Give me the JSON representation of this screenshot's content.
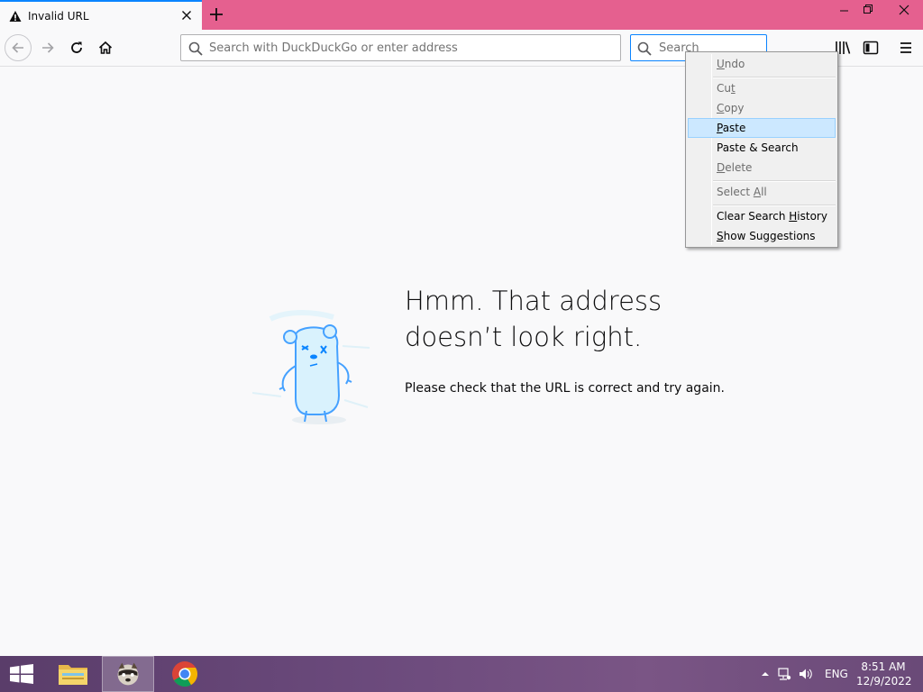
{
  "browser": {
    "tab": {
      "title": "Invalid URL",
      "icon": "warning-icon"
    },
    "urlbar": {
      "placeholder": "Search with DuckDuckGo or enter address",
      "value": ""
    },
    "searchbar": {
      "placeholder": "Search",
      "value": ""
    }
  },
  "page": {
    "title_line1": "Hmm. That address",
    "title_line2": "doesn’t look right.",
    "description": "Please check that the URL is correct and try again."
  },
  "context_menu": {
    "items": [
      {
        "label": "Undo",
        "accel": "U",
        "enabled": false
      },
      {
        "label": "Cut",
        "accel": "t",
        "enabled": false
      },
      {
        "label": "Copy",
        "accel": "C",
        "enabled": false
      },
      {
        "label": "Paste",
        "accel": "P",
        "enabled": true,
        "highlighted": true
      },
      {
        "label": "Paste & Search",
        "accel": "",
        "enabled": true
      },
      {
        "label": "Delete",
        "accel": "D",
        "enabled": false
      },
      {
        "label": "Select All",
        "accel": "A",
        "enabled": false
      },
      {
        "label": "Clear Search History",
        "accel": "H",
        "enabled": true
      },
      {
        "label": "Show Suggestions",
        "accel": "S",
        "enabled": true
      }
    ]
  },
  "taskbar": {
    "apps": [
      "file-explorer-icon",
      "firefox-icon",
      "chrome-icon"
    ],
    "active_app": "firefox-icon",
    "language": "ENG",
    "time": "8:51 AM",
    "date": "12/9/2022"
  },
  "colors": {
    "tabbar_bg": "#e5608f",
    "accent": "#0a84ff",
    "menu_highlight": "#cce8ff"
  }
}
